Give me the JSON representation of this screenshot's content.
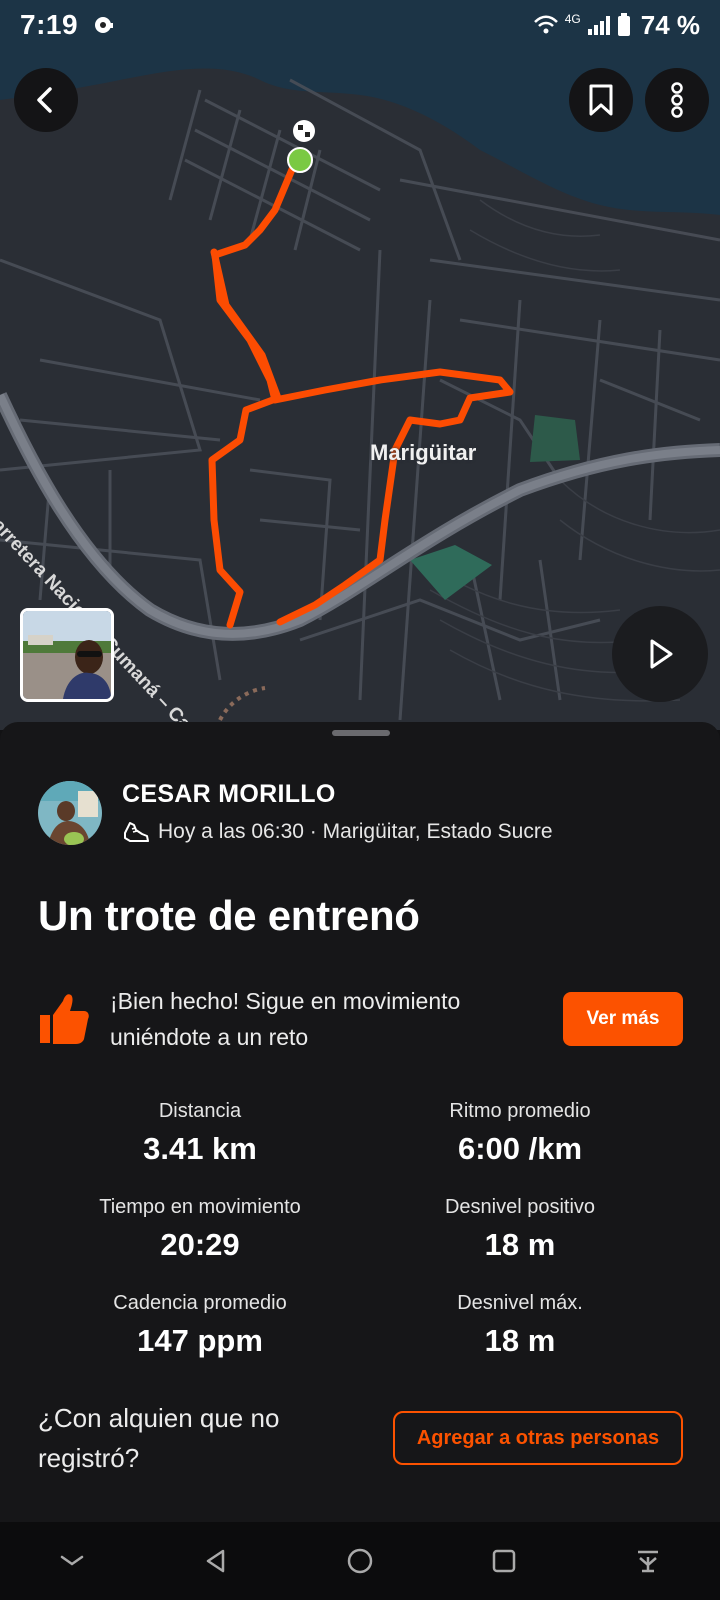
{
  "status_bar": {
    "time": "7:19",
    "network": "4G",
    "battery": "74 %"
  },
  "map": {
    "place_label": "Marigüitar",
    "road_label": "Carretera Nacional Cumaná – Carúpano",
    "route_color": "#fc4c02",
    "start_color": "#7ac943"
  },
  "athlete": {
    "name": "CESAR MORILLO",
    "meta": "Hoy a las 06:30 · Marigüitar, Estado Sucre"
  },
  "activity": {
    "title": "Un trote de entrenó"
  },
  "challenge": {
    "text": "¡Bien hecho! Sigue en movimiento uniéndote a un reto",
    "button": "Ver más"
  },
  "stats": [
    {
      "label": "Distancia",
      "value": "3.41 km"
    },
    {
      "label": "Ritmo promedio",
      "value": "6:00 /km"
    },
    {
      "label": "Tiempo en movimiento",
      "value": "20:29"
    },
    {
      "label": "Desnivel positivo",
      "value": "18 m"
    },
    {
      "label": "Cadencia promedio",
      "value": "147 ppm"
    },
    {
      "label": "Desnivel máx.",
      "value": "18 m"
    }
  ],
  "add_people": {
    "question": "¿Con alquien que no registró?",
    "button": "Agregar a otras personas"
  },
  "accent_color": "#fc5200"
}
